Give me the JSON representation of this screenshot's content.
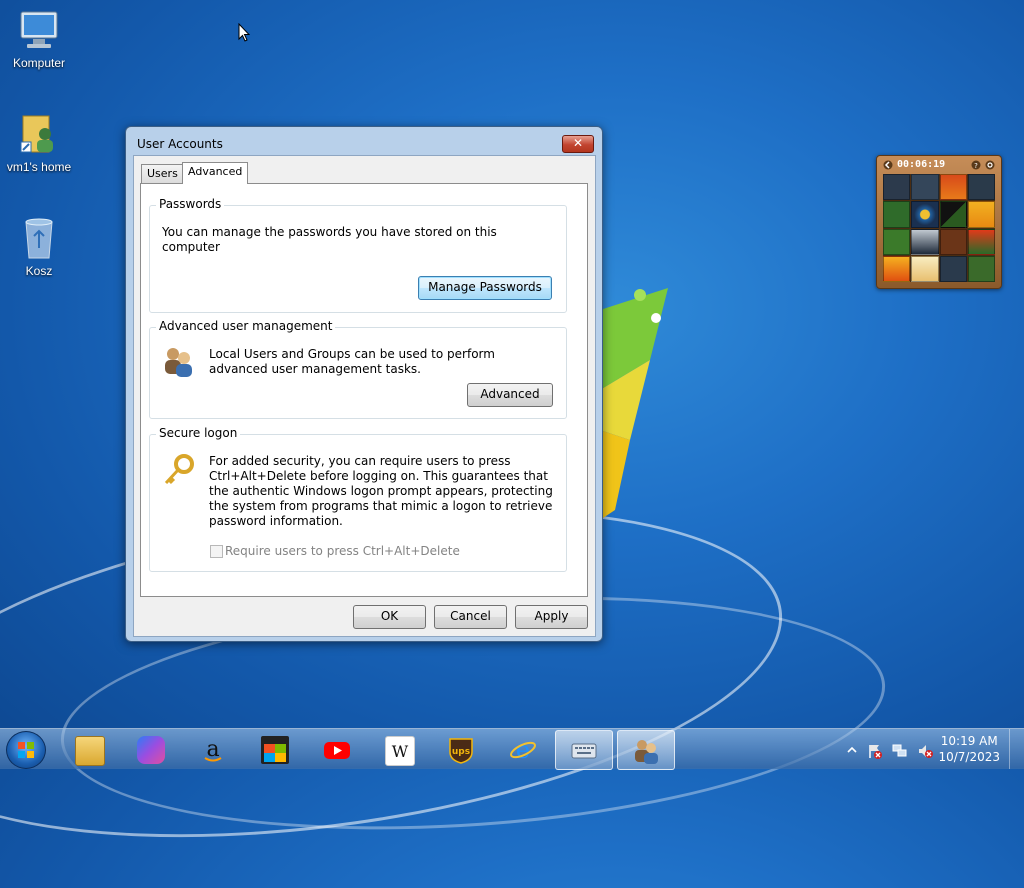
{
  "desktop": {
    "icons": [
      {
        "label": "Komputer",
        "icon": "computer-icon"
      },
      {
        "label": "vm1's home",
        "icon": "user-folder-icon"
      },
      {
        "label": "Kosz",
        "icon": "recycle-bin-icon"
      }
    ]
  },
  "window": {
    "title": "User Accounts",
    "close_label": "✕",
    "tabs": [
      {
        "label": "Users",
        "active": false
      },
      {
        "label": "Advanced",
        "active": true
      }
    ],
    "passwords": {
      "heading": "Passwords",
      "text": "You can manage the passwords you have stored on this computer",
      "button": "Manage Passwords"
    },
    "advanced_mgmt": {
      "heading": "Advanced user management",
      "text": "Local Users and Groups can be used to perform advanced user management tasks.",
      "button": "Advanced",
      "icon": "users-icon"
    },
    "secure_logon": {
      "heading": "Secure logon",
      "text": "For added security, you can require users to press Ctrl+Alt+Delete before logging on. This guarantees that the authentic Windows logon prompt appears, protecting the system from programs that mimic a logon to retrieve password information.",
      "checkbox_label": "Require users to press Ctrl+Alt+Delete",
      "checkbox_checked": false,
      "icon": "key-icon"
    },
    "footer": {
      "ok": "OK",
      "cancel": "Cancel",
      "apply": "Apply"
    }
  },
  "gadget": {
    "timer": "00:06:19",
    "help_icon": "help-icon",
    "settings_icon": "settings-icon"
  },
  "taskbar": {
    "apps": [
      {
        "name": "file-explorer-icon"
      },
      {
        "name": "copilot-icon"
      },
      {
        "name": "amazon-icon"
      },
      {
        "name": "store-icon"
      },
      {
        "name": "youtube-icon"
      },
      {
        "name": "wikipedia-icon"
      },
      {
        "name": "ups-icon"
      },
      {
        "name": "internet-explorer-icon"
      },
      {
        "name": "on-screen-keyboard-icon"
      },
      {
        "name": "user-accounts-icon"
      }
    ],
    "time": "10:19 AM",
    "date": "10/7/2023"
  }
}
